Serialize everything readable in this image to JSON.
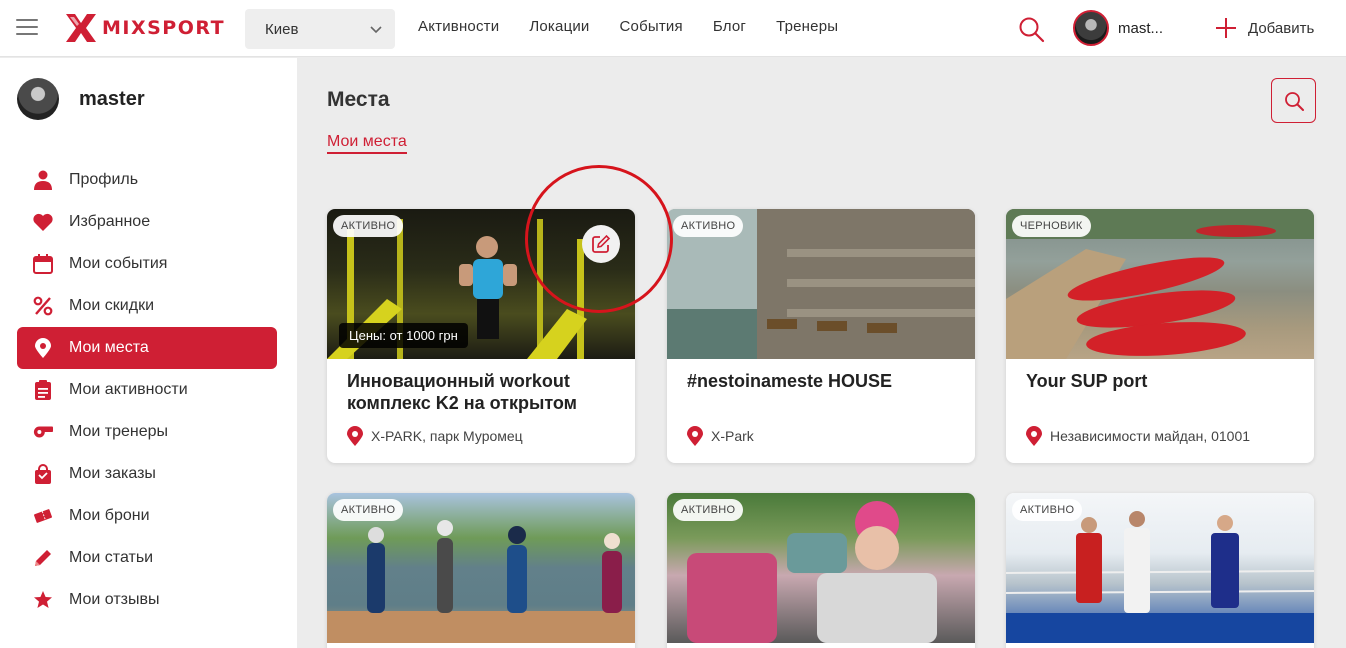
{
  "brand": {
    "logo_text": "MIXSPORT",
    "accent": "#cf1f34"
  },
  "header": {
    "city": "Киев",
    "nav": [
      "Активности",
      "Локации",
      "События",
      "Блог",
      "Тренеры"
    ],
    "user_name": "mast...",
    "add_label": "Добавить"
  },
  "sidebar": {
    "profile_name": "master",
    "items": [
      {
        "label": "Профиль",
        "icon": "user-icon"
      },
      {
        "label": "Избранное",
        "icon": "heart-icon"
      },
      {
        "label": "Мои события",
        "icon": "calendar-icon"
      },
      {
        "label": "Мои скидки",
        "icon": "percent-icon"
      },
      {
        "label": "Мои места",
        "icon": "map-pin-icon",
        "active": true
      },
      {
        "label": "Мои активности",
        "icon": "clipboard-icon"
      },
      {
        "label": "Мои тренеры",
        "icon": "whistle-icon"
      },
      {
        "label": "Мои заказы",
        "icon": "shopping-bag-icon"
      },
      {
        "label": "Мои брони",
        "icon": "ticket-icon"
      },
      {
        "label": "Мои статьи",
        "icon": "pencil-icon"
      },
      {
        "label": "Мои отзывы",
        "icon": "star-icon"
      }
    ]
  },
  "main": {
    "title": "Места",
    "tab": "Мои места",
    "cards": [
      {
        "status": "АКТИВНО",
        "price": "Цены: от 1000 грн",
        "name": "Инновационный workout комплекс K2 на открытом",
        "location": "X-PARK, парк Муромец"
      },
      {
        "status": "АКТИВНО",
        "name": "#nestoinameste HOUSE",
        "location": "X-Park"
      },
      {
        "status": "ЧЕРНОВИК",
        "name": "Your SUP port",
        "location": "Независимости майдан, 01001"
      },
      {
        "status": "АКТИВНО"
      },
      {
        "status": "АКТИВНО"
      },
      {
        "status": "АКТИВНО"
      }
    ]
  }
}
